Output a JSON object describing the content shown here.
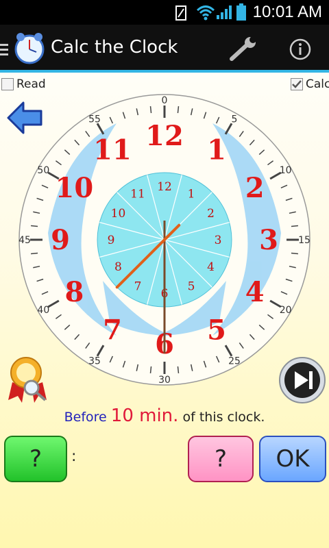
{
  "status_bar": {
    "time": "10:01 AM"
  },
  "app_bar": {
    "title": "Calc the Clock"
  },
  "options": {
    "read_label": "Read",
    "read_checked": false,
    "calc_label": "Calc",
    "calc_checked": true
  },
  "clock": {
    "hour_numerals": [
      "12",
      "1",
      "2",
      "3",
      "4",
      "5",
      "6",
      "7",
      "8",
      "9",
      "10",
      "11"
    ],
    "inner_numerals": [
      "12",
      "1",
      "2",
      "3",
      "4",
      "5",
      "6",
      "7",
      "8",
      "9",
      "10",
      "11"
    ],
    "minute_labels": [
      "0",
      "5",
      "10",
      "15",
      "20",
      "25",
      "30",
      "35",
      "40",
      "45",
      "50",
      "55"
    ],
    "time_shown": {
      "hour": 7,
      "minute": 30
    },
    "colors": {
      "hour_hand": "#e0601a",
      "minute_hand": "#7a4a2a",
      "numerals": "#e01a1a",
      "inner_face": "#8ee6f0"
    }
  },
  "question": {
    "prefix": "Before",
    "value": "10 min.",
    "suffix": "of this clock."
  },
  "answer": {
    "hour_button": "?",
    "separator": ":",
    "minute_button": "?",
    "ok_button": "OK"
  }
}
